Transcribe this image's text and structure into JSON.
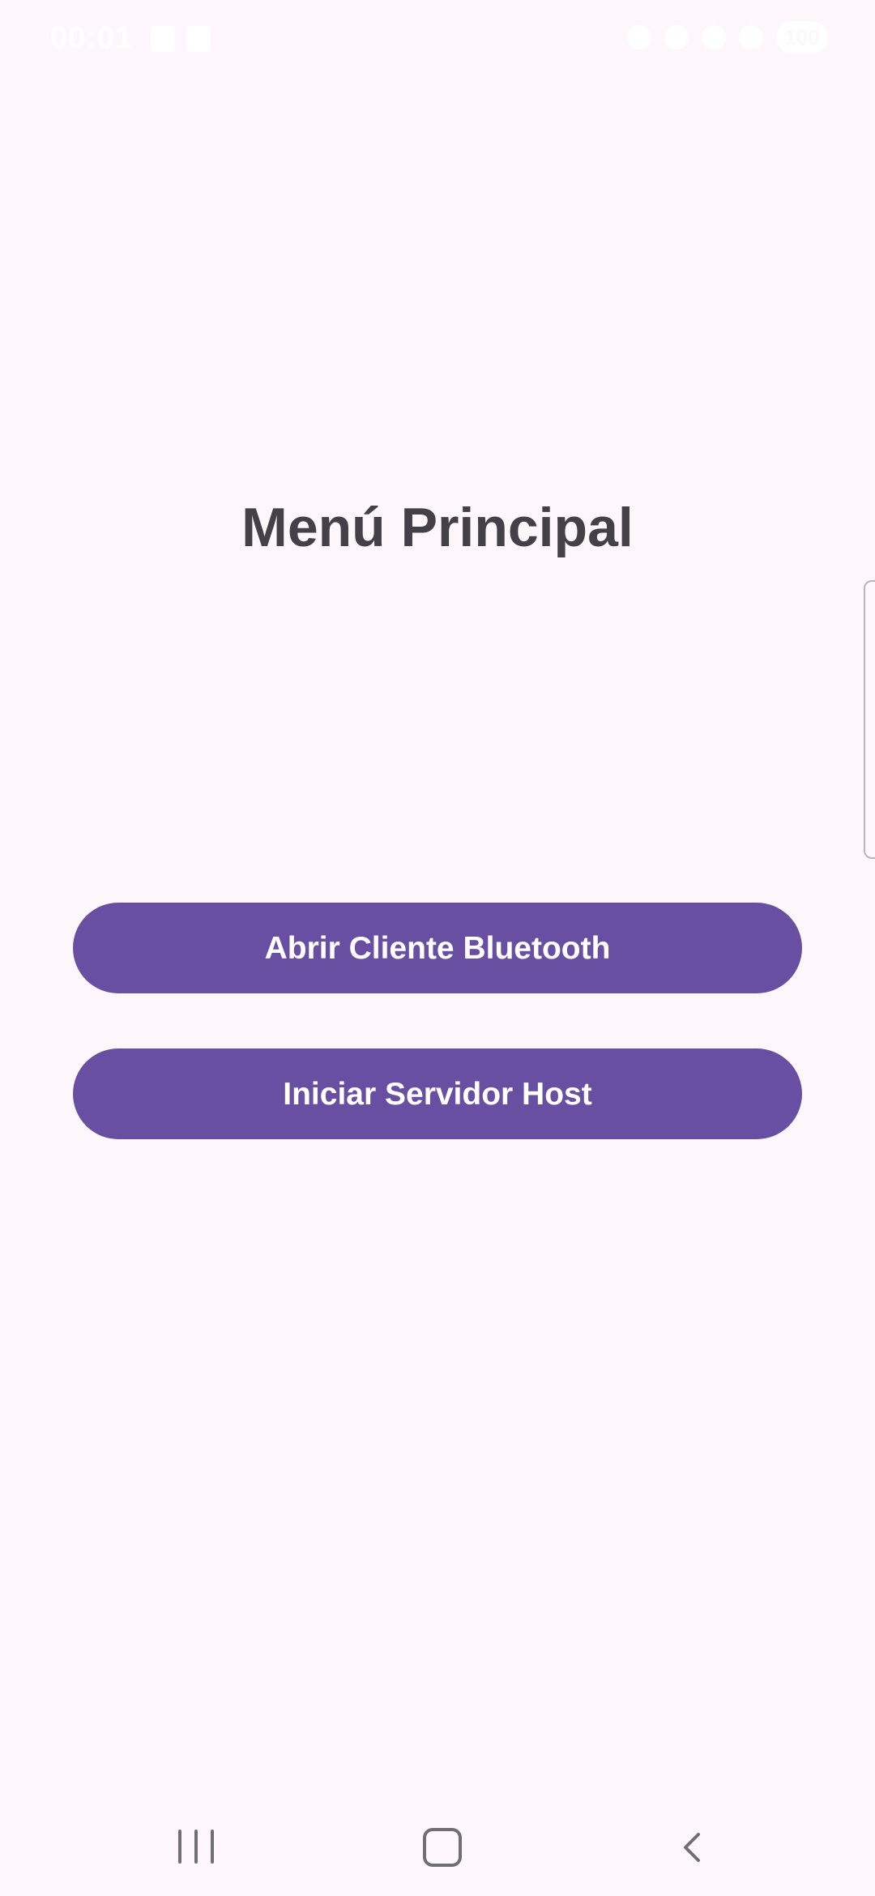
{
  "status_bar": {
    "time": "00:01",
    "battery": "100"
  },
  "main": {
    "title": "Menú Principal",
    "buttons": {
      "client_label": "Abrir Cliente Bluetooth",
      "server_label": "Iniciar Servidor Host"
    }
  },
  "colors": {
    "background": "#fdf7fc",
    "button": "#684fa2",
    "title": "#444047"
  },
  "icons": {
    "status_left": [
      "gallery-icon",
      "sim-icon"
    ],
    "status_right": [
      "mute-icon",
      "location-icon",
      "wifi-icon",
      "signal-icon"
    ],
    "nav": [
      "recents-icon",
      "home-icon",
      "back-icon"
    ]
  }
}
